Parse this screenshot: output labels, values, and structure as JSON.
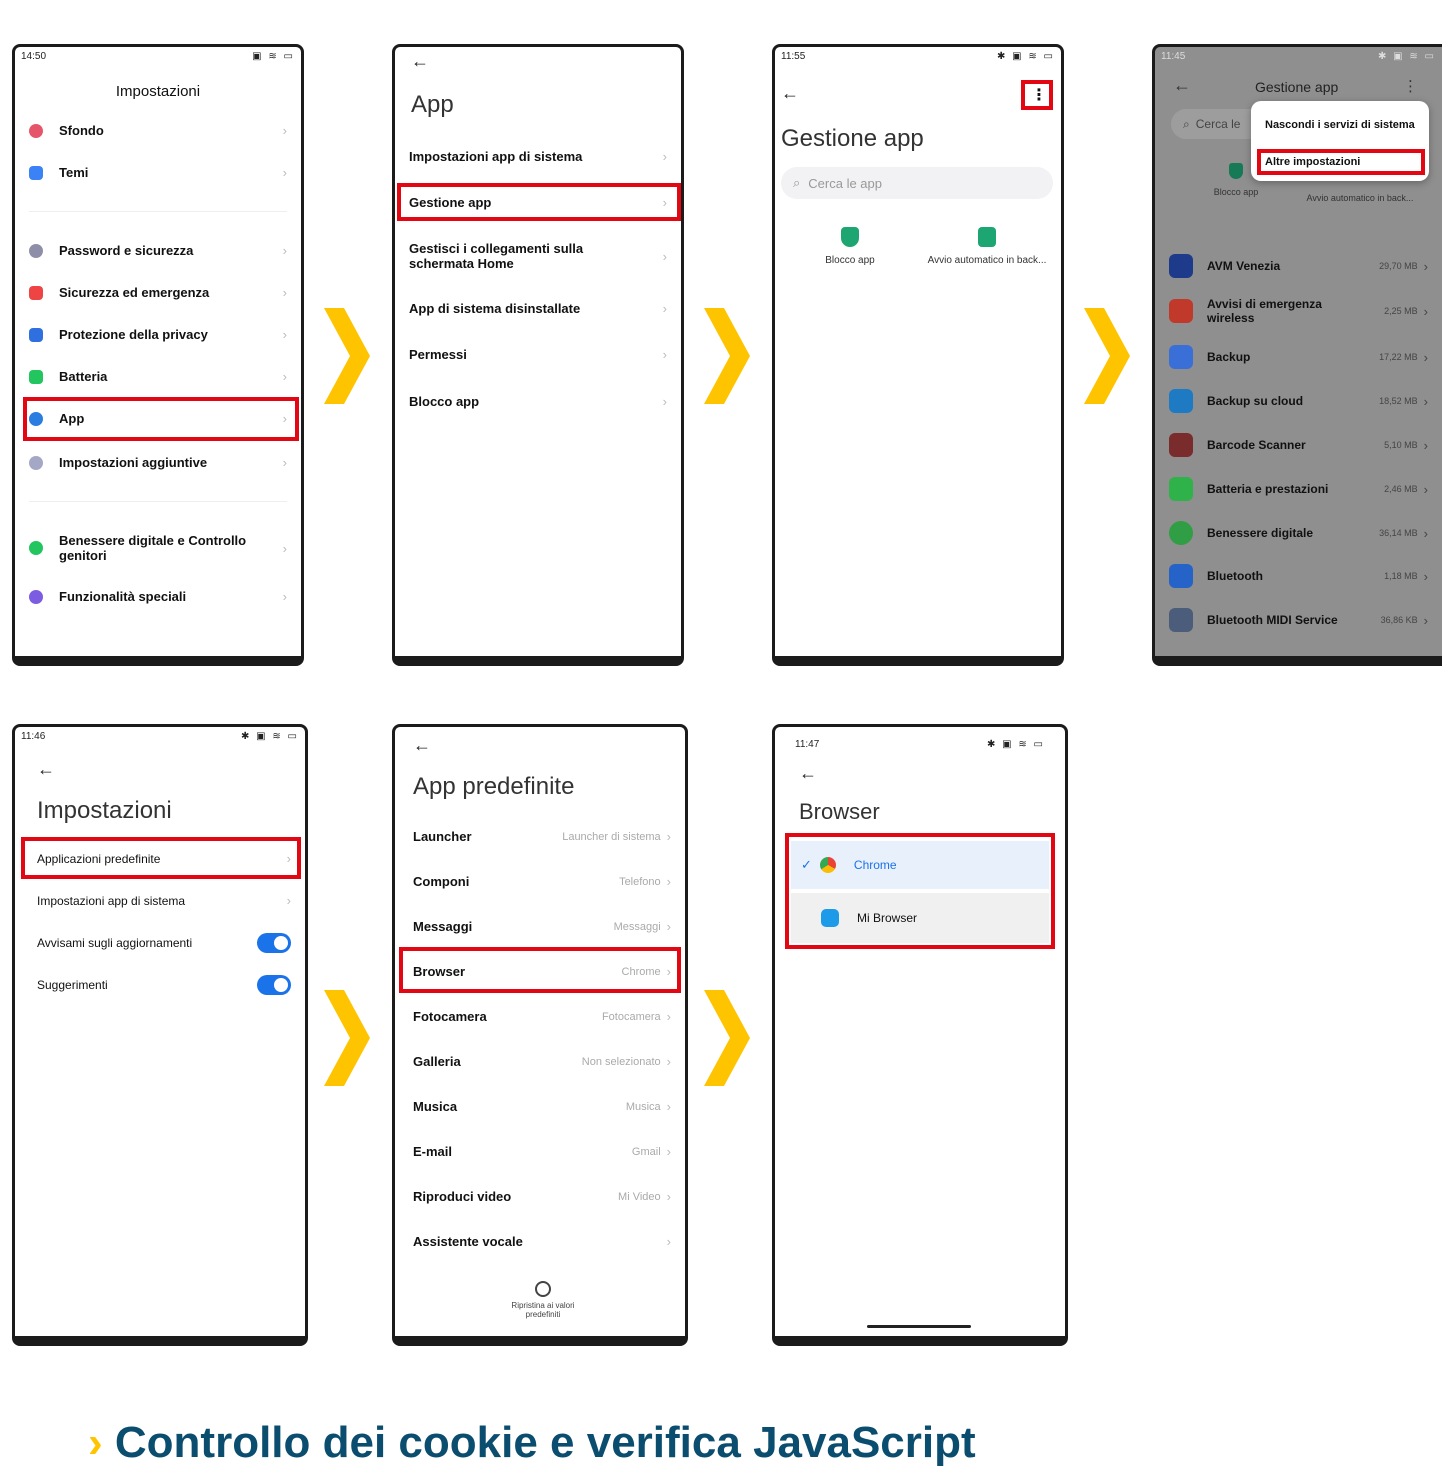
{
  "phone1": {
    "status_time": "14:50",
    "title": "Impostazioni",
    "items": [
      {
        "label": "Sfondo",
        "color": "#e5566a"
      },
      {
        "label": "Temi",
        "color": "#3b82f6"
      },
      {
        "label": "Password e sicurezza",
        "color": "#8e8ea8"
      },
      {
        "label": "Sicurezza ed emergenza",
        "color": "#ef4444"
      },
      {
        "label": "Protezione della privacy",
        "color": "#2f6fe0"
      },
      {
        "label": "Batteria",
        "color": "#22c55e"
      },
      {
        "label": "App",
        "color": "#2a7de1"
      },
      {
        "label": "Impostazioni aggiuntive",
        "color": "#a4a8c4"
      },
      {
        "label": "Benessere digitale e Controllo genitori",
        "color": "#22c55e"
      },
      {
        "label": "Funzionalità speciali",
        "color": "#7c5ce0"
      }
    ]
  },
  "phone2": {
    "title": "App",
    "items": [
      "Impostazioni app di sistema",
      "Gestione app",
      "Gestisci i collegamenti sulla schermata Home",
      "App di sistema disinstallate",
      "Permessi",
      "Blocco app"
    ]
  },
  "phone3": {
    "status_time": "11:55",
    "title": "Gestione app",
    "search_placeholder": "Cerca le app",
    "shortcuts": [
      "Blocco app",
      "Avvio automatico in back..."
    ]
  },
  "phone4": {
    "status_time": "11:45",
    "title": "Gestione app",
    "search_placeholder": "Cerca le",
    "menu": [
      "Nascondi i servizi di sistema",
      "Altre impostazioni"
    ],
    "shortcuts": [
      "Blocco app",
      "Avvio automatico in back..."
    ],
    "apps": [
      {
        "name": "AVM Venezia",
        "size": "29,70 MB",
        "color": "#1e3a8a"
      },
      {
        "name": "Avvisi di emergenza wireless",
        "size": "2,25 MB",
        "color": "#c0392b"
      },
      {
        "name": "Backup",
        "size": "17,22 MB",
        "color": "#3b6fd8"
      },
      {
        "name": "Backup su cloud",
        "size": "18,52 MB",
        "color": "#1f7ac4"
      },
      {
        "name": "Barcode Scanner",
        "size": "5,10 MB",
        "color": "#7a2b2b"
      },
      {
        "name": "Batteria e prestazioni",
        "size": "2,46 MB",
        "color": "#2fb24a"
      },
      {
        "name": "Benessere digitale",
        "size": "36,14 MB",
        "color": "#2f9e44"
      },
      {
        "name": "Bluetooth",
        "size": "1,18 MB",
        "color": "#2563c9"
      },
      {
        "name": "Bluetooth MIDI Service",
        "size": "36,86 KB",
        "color": "#4b5d7a"
      }
    ]
  },
  "phone5": {
    "status_time": "11:46",
    "title": "Impostazioni",
    "items": [
      {
        "label": "Applicazioni predefinite"
      },
      {
        "label": "Impostazioni app di sistema"
      },
      {
        "label": "Avvisami sugli aggiornamenti"
      },
      {
        "label": "Suggerimenti"
      }
    ]
  },
  "phone6": {
    "title": "App predefinite",
    "items": [
      {
        "label": "Launcher",
        "value": "Launcher di sistema"
      },
      {
        "label": "Componi",
        "value": "Telefono"
      },
      {
        "label": "Messaggi",
        "value": "Messaggi"
      },
      {
        "label": "Browser",
        "value": "Chrome"
      },
      {
        "label": "Fotocamera",
        "value": "Fotocamera"
      },
      {
        "label": "Galleria",
        "value": "Non selezionato"
      },
      {
        "label": "Musica",
        "value": "Musica"
      },
      {
        "label": "E-mail",
        "value": "Gmail"
      },
      {
        "label": "Riproduci video",
        "value": "Mi Video"
      },
      {
        "label": "Assistente vocale",
        "value": ""
      }
    ],
    "reset_label": "Ripristina ai valori predefiniti"
  },
  "phone7": {
    "status_time": "11:47",
    "title": "Browser",
    "options": [
      {
        "label": "Chrome",
        "selected": true
      },
      {
        "label": "Mi Browser",
        "selected": false
      }
    ]
  },
  "heading": "Controllo dei cookie e verifica JavaScript",
  "colors": {
    "highlight": "#e30613",
    "arrow": "#ffc400",
    "heading": "#0b4d6e",
    "accent": "#1a73e8"
  }
}
